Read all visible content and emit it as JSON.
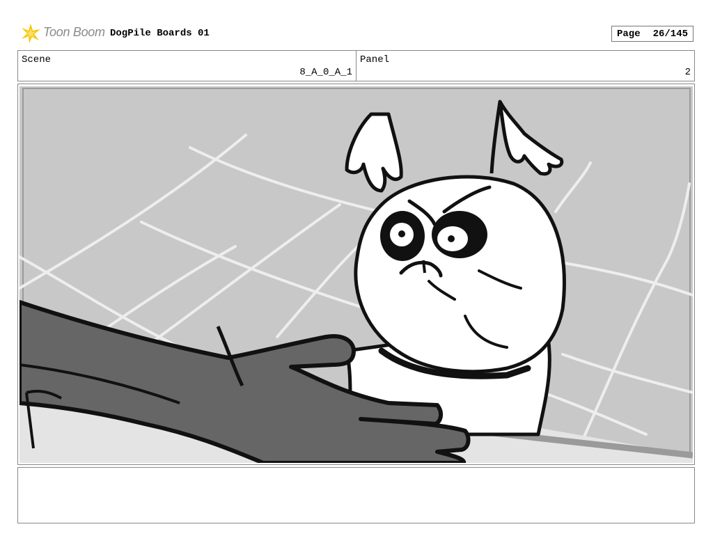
{
  "header": {
    "brand": "Toon Boom",
    "brand_icon": "star-burst-icon",
    "project_title": "DogPile Boards 01",
    "page_label": "Page",
    "page_value": "26/145"
  },
  "scene": {
    "label": "Scene",
    "value": "8_A_0_A_1"
  },
  "panel": {
    "label": "Panel",
    "value": "2"
  },
  "colors": {
    "border": "#888888",
    "brand_yellow": "#f2c200",
    "brand_gray": "#8a8a8a"
  }
}
